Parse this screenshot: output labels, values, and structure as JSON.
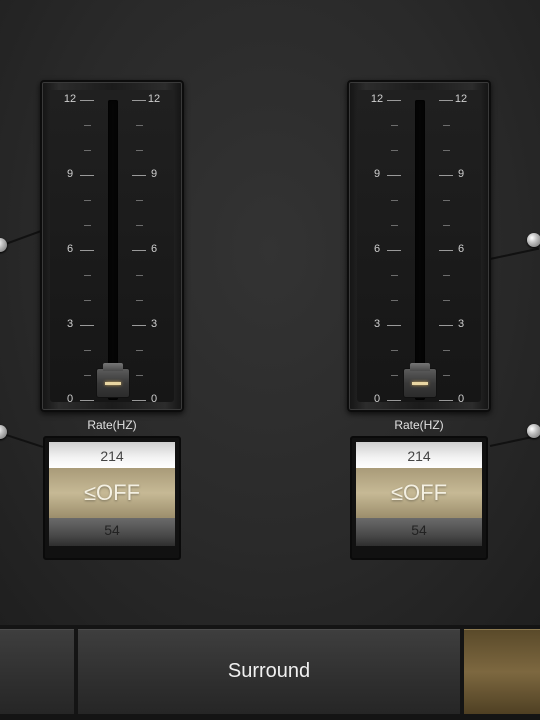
{
  "units": [
    {
      "scale_left": [
        "12",
        "9",
        "6",
        "3",
        "0"
      ],
      "scale_right": [
        "12",
        "9",
        "6",
        "3",
        "0"
      ],
      "slider_value": 0,
      "slider_max": 12,
      "rate_label": "Rate(HZ)",
      "picker": {
        "above": "214",
        "selected": "≤OFF",
        "below": "54"
      }
    },
    {
      "scale_left": [
        "12",
        "9",
        "6",
        "3",
        "0"
      ],
      "scale_right": [
        "12",
        "9",
        "6",
        "3",
        "0"
      ],
      "slider_value": 0,
      "slider_max": 12,
      "rate_label": "Rate(HZ)",
      "picker": {
        "above": "214",
        "selected": "≤OFF",
        "below": "54"
      }
    }
  ],
  "tabs": [
    {
      "label": ""
    },
    {
      "label": "Surround"
    },
    {
      "label": ""
    }
  ],
  "colors": {
    "accent": "#c6b995",
    "indicator": "#e9d6a2",
    "background": "#2b2b2b"
  }
}
